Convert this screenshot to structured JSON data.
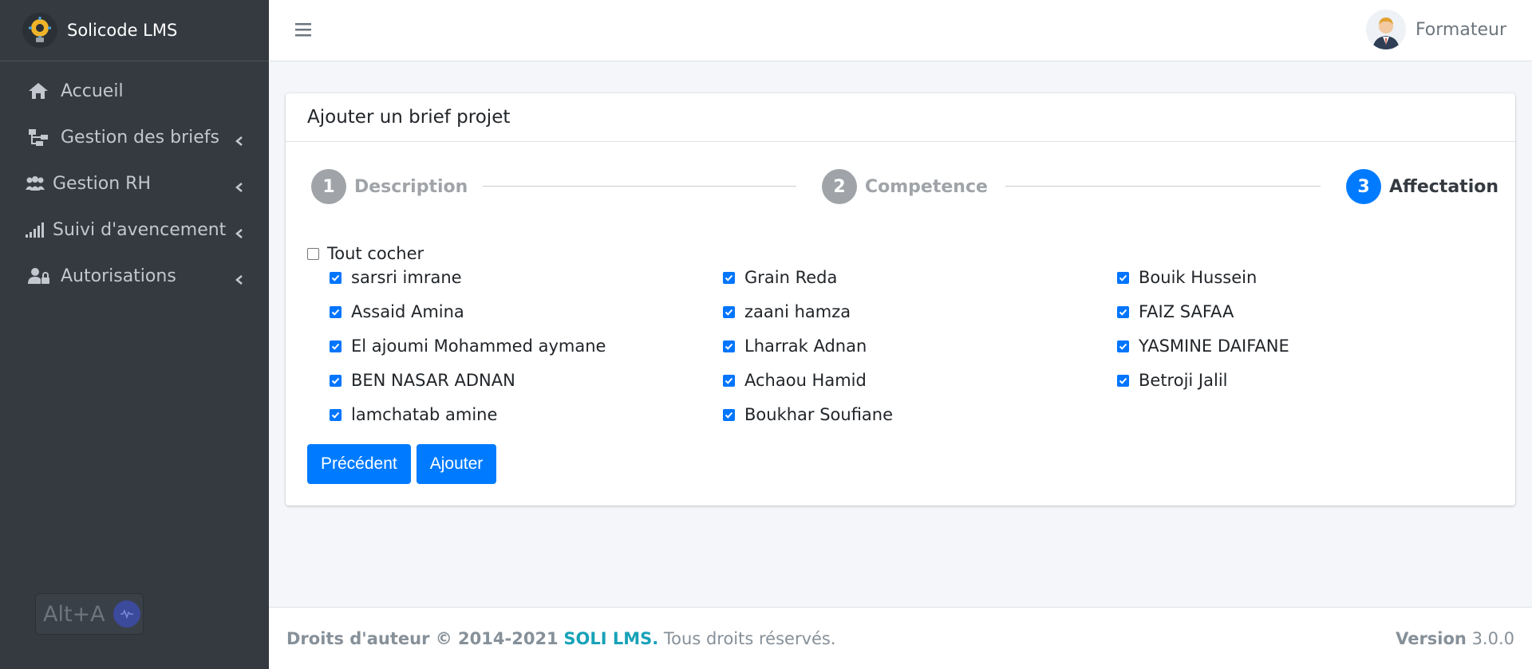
{
  "brand": {
    "name": "Solicode LMS",
    "logo_icon": "lightbulb-gear-icon"
  },
  "sidebar": {
    "items": [
      {
        "label": "Accueil",
        "icon": "home-icon",
        "has_submenu": false
      },
      {
        "label": "Gestion des briefs",
        "icon": "sitemap-icon",
        "has_submenu": true
      },
      {
        "label": "Gestion RH",
        "icon": "users-icon",
        "has_submenu": true
      },
      {
        "label": "Suivi d'avencement",
        "icon": "signal-icon",
        "has_submenu": true
      },
      {
        "label": "Autorisations",
        "icon": "user-lock-icon",
        "has_submenu": true
      }
    ],
    "shortcut_badge": "Alt+A"
  },
  "topbar": {
    "menu_icon": "hamburger-icon",
    "user_name": "Formateur"
  },
  "card": {
    "title": "Ajouter un brief projet",
    "steps": [
      {
        "number": "1",
        "label": "Description",
        "active": false
      },
      {
        "number": "2",
        "label": "Competence",
        "active": false
      },
      {
        "number": "3",
        "label": "Affectation",
        "active": true
      }
    ],
    "check_all_label": "Tout cocher",
    "check_all_checked": false,
    "learners": [
      {
        "name": "sarsri imrane",
        "checked": true
      },
      {
        "name": "Grain Reda",
        "checked": true
      },
      {
        "name": "Bouik Hussein",
        "checked": true
      },
      {
        "name": "Assaid Amina",
        "checked": true
      },
      {
        "name": "zaani hamza",
        "checked": true
      },
      {
        "name": "FAIZ SAFAA",
        "checked": true
      },
      {
        "name": "El ajoumi Mohammed aymane",
        "checked": true
      },
      {
        "name": "Lharrak Adnan",
        "checked": true
      },
      {
        "name": "YASMINE DAIFANE",
        "checked": true
      },
      {
        "name": "BEN NASAR ADNAN",
        "checked": true
      },
      {
        "name": "Achaou Hamid",
        "checked": true
      },
      {
        "name": "Betroji Jalil",
        "checked": true
      },
      {
        "name": "lamchatab amine",
        "checked": true
      },
      {
        "name": "Boukhar Soufiane",
        "checked": true
      }
    ],
    "prev_button": "Précédent",
    "add_button": "Ajouter"
  },
  "footer": {
    "copyright": "Droits d'auteur © 2014-2021",
    "brand_link": "SOLI LMS.",
    "rights": "Tous droits réservés.",
    "version_label": "Version",
    "version": "3.0.0"
  },
  "colors": {
    "sidebar_bg": "#343a40",
    "primary": "#007bff",
    "link": "#17a2b8",
    "inactive_step": "#a0a4a8"
  }
}
